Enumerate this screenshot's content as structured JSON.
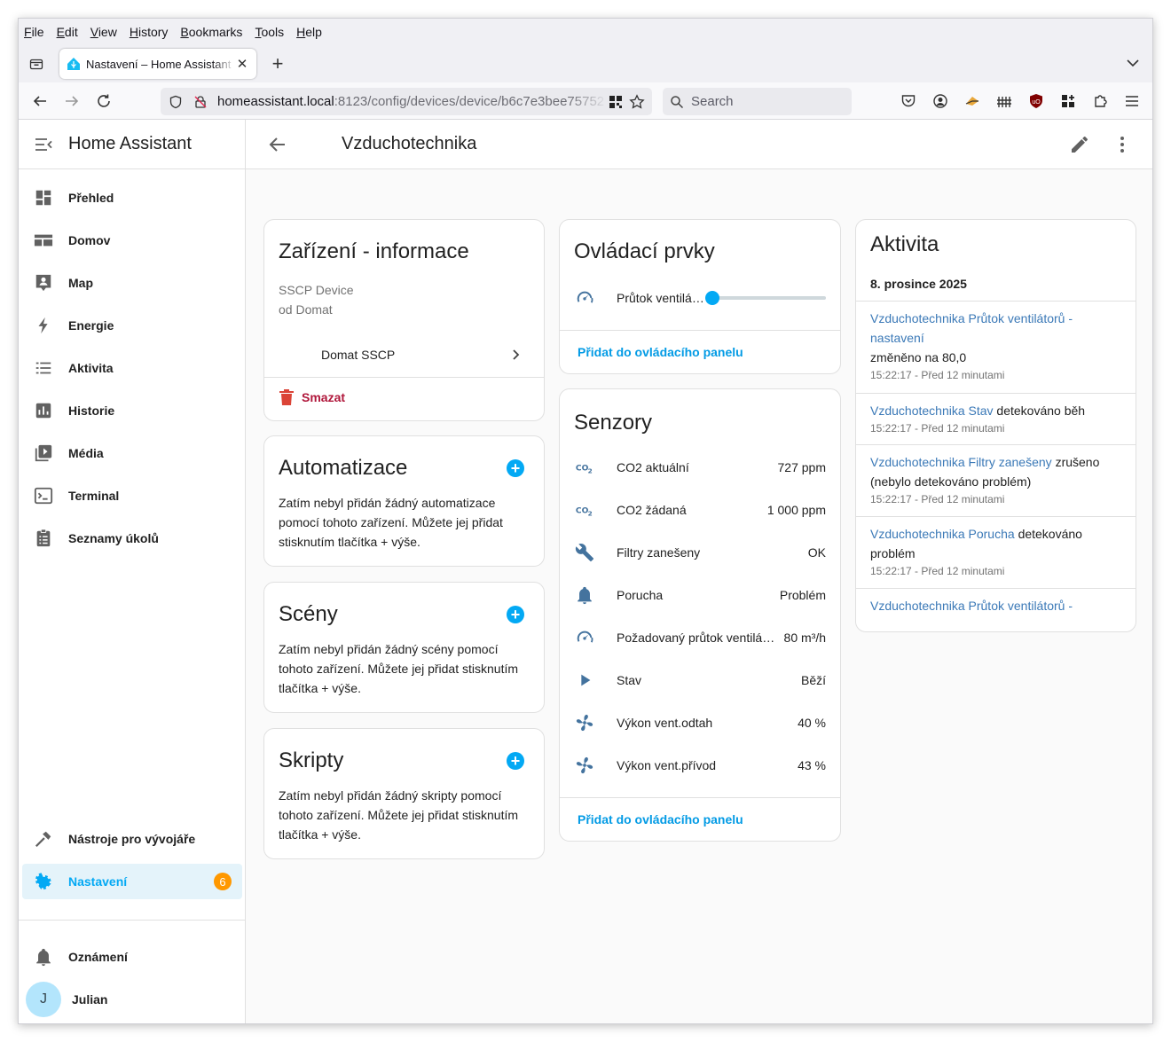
{
  "browser": {
    "menu": [
      "File",
      "Edit",
      "View",
      "History",
      "Bookmarks",
      "Tools",
      "Help"
    ],
    "tab_title": "Nastavení – Home Assistant",
    "url_host": "homeassistant.local",
    "url_rest": ":8123/config/devices/device/b6c7e3bee75752",
    "search_placeholder": "Search"
  },
  "sidebar": {
    "title": "Home Assistant",
    "items": [
      {
        "label": "Přehled",
        "icon": "dashboard-icon"
      },
      {
        "label": "Domov",
        "icon": "view-dashboard-icon"
      },
      {
        "label": "Map",
        "icon": "map-account-icon"
      },
      {
        "label": "Energie",
        "icon": "lightning-icon"
      },
      {
        "label": "Aktivita",
        "icon": "list-icon"
      },
      {
        "label": "Historie",
        "icon": "chart-box-icon"
      },
      {
        "label": "Média",
        "icon": "play-box-multiple-icon"
      },
      {
        "label": "Terminal",
        "icon": "console-icon"
      },
      {
        "label": "Seznamy úkolů",
        "icon": "clipboard-list-icon"
      }
    ],
    "dev_tools": "Nástroje pro vývojáře",
    "settings": "Nastavení",
    "settings_badge": "6",
    "notifications": "Oznámení",
    "user": "Julian",
    "user_initial": "J"
  },
  "page": {
    "title": "Vzduchotechnika"
  },
  "device_info": {
    "title": "Zařízení - informace",
    "model": "SSCP Device",
    "manufacturer": "od Domat",
    "integration": "Domat SSCP",
    "delete": "Smazat"
  },
  "automations": {
    "title": "Automatizace",
    "text": "Zatím nebyl přidán žádný automatizace pomocí tohoto zařízení. Můžete jej přidat stisknutím tlačítka + výše."
  },
  "scenes": {
    "title": "Scény",
    "text": "Zatím nebyl přidán žádný scény pomocí tohoto zařízení. Můžete jej přidat stisknutím tlačítka + výše."
  },
  "scripts": {
    "title": "Skripty",
    "text": "Zatím nebyl přidán žádný skripty pomocí tohoto zařízení. Můžete jej přidat stisknutím tlačítka + výše."
  },
  "controls": {
    "title": "Ovládací prvky",
    "slider_name": "Průtok ventilá…",
    "slider_value": 0,
    "add": "Přidat do ovládacího panelu"
  },
  "sensors": {
    "title": "Senzory",
    "rows": [
      {
        "name": "CO2 aktuální",
        "value": "727 ppm",
        "icon": "co2-icon"
      },
      {
        "name": "CO2 žádaná",
        "value": "1 000 ppm",
        "icon": "co2-icon"
      },
      {
        "name": "Filtry zanešeny",
        "value": "OK",
        "icon": "wrench-icon"
      },
      {
        "name": "Porucha",
        "value": "Problém",
        "icon": "bell-icon"
      },
      {
        "name": "Požadovaný průtok ventilá…",
        "value": "80 m³/h",
        "icon": "gauge-icon"
      },
      {
        "name": "Stav",
        "value": "Běží",
        "icon": "play-icon"
      },
      {
        "name": "Výkon vent.odtah",
        "value": "40 %",
        "icon": "fan-icon"
      },
      {
        "name": "Výkon vent.přívod",
        "value": "43 %",
        "icon": "fan-icon"
      }
    ],
    "add": "Přidat do ovládacího panelu"
  },
  "activity": {
    "title": "Aktivita",
    "date": "8. prosince 2025",
    "entries": [
      {
        "entity": "Vzduchotechnika Průtok ventilátorů - nastavení",
        "action": "změněno na 80,0",
        "time": "15:22:17 - Před 12 minutami"
      },
      {
        "entity": "Vzduchotechnika Stav",
        "action": "detekováno běh",
        "time": "15:22:17 - Před 12 minutami"
      },
      {
        "entity": "Vzduchotechnika Filtry zanešeny",
        "action": "zrušeno (nebylo detekováno problém)",
        "time": "15:22:17 - Před 12 minutami"
      },
      {
        "entity": "Vzduchotechnika Porucha",
        "action": "detekováno problém",
        "time": "15:22:17 - Před 12 minutami"
      },
      {
        "entity": "Vzduchotechnika Průtok ventilátorů -",
        "action": "",
        "time": ""
      }
    ]
  },
  "colors": {
    "accent": "#03a9f4",
    "icon": "#44739e",
    "danger": "#db4437",
    "badge": "#ff9800"
  }
}
